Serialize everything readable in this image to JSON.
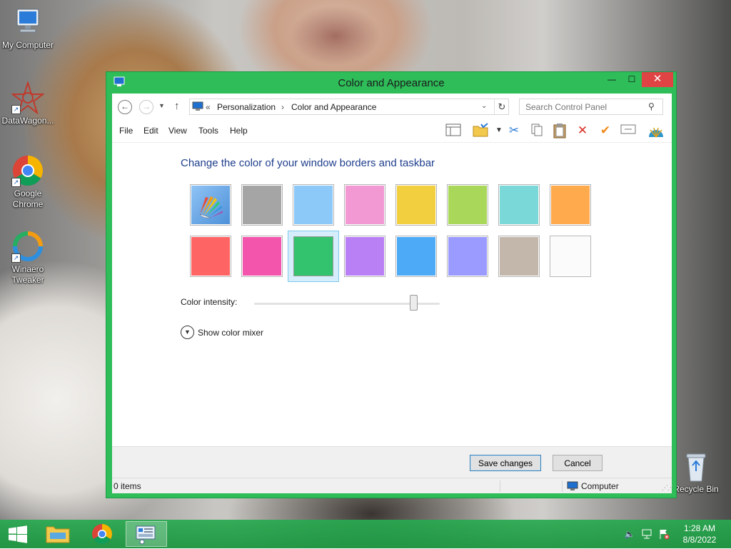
{
  "desktop": {
    "icons": [
      {
        "label": "My Computer",
        "icon": "computer-icon"
      },
      {
        "label": "DataWagon...",
        "icon": "datawagon-icon"
      },
      {
        "label": "Google Chrome",
        "icon": "chrome-icon"
      },
      {
        "label": "Winaero Tweaker",
        "icon": "winaero-icon"
      },
      {
        "label": "Recycle Bin",
        "icon": "recycle-bin-icon"
      }
    ]
  },
  "window": {
    "title": "Color and Appearance",
    "controls": {
      "minimize": "—",
      "maximize": "☐",
      "close": "✕"
    },
    "address": {
      "overflow": "«",
      "crumbs": [
        "Personalization",
        "Color and Appearance"
      ],
      "separator": "›"
    },
    "search": {
      "placeholder": "Search Control Panel"
    },
    "menu": [
      "File",
      "Edit",
      "View",
      "Tools",
      "Help"
    ],
    "toolbar_icons": [
      "layout-pane-icon",
      "folder-options-icon",
      "dropdown-arrow-icon",
      "cut-icon",
      "copy-icon",
      "paste-icon",
      "delete-icon",
      "properties-check-icon",
      "rename-icon",
      "shell-icon"
    ],
    "content": {
      "heading": "Change the color of your window borders and taskbar",
      "swatches": [
        {
          "name": "automatic",
          "color": "#5b9bd5",
          "selected": false
        },
        {
          "name": "gray",
          "color": "#a5a5a5",
          "selected": false
        },
        {
          "name": "sky-blue",
          "color": "#8cc8f8",
          "selected": false
        },
        {
          "name": "pink",
          "color": "#f299d4",
          "selected": false
        },
        {
          "name": "yellow",
          "color": "#f2cf3e",
          "selected": false
        },
        {
          "name": "lime",
          "color": "#a9d75a",
          "selected": false
        },
        {
          "name": "teal",
          "color": "#7ad8d8",
          "selected": false
        },
        {
          "name": "orange",
          "color": "#ffaa4d",
          "selected": false
        },
        {
          "name": "red",
          "color": "#ff6464",
          "selected": false
        },
        {
          "name": "magenta",
          "color": "#f354ac",
          "selected": false
        },
        {
          "name": "green",
          "color": "#33c26d",
          "selected": true
        },
        {
          "name": "violet",
          "color": "#b97ff5",
          "selected": false
        },
        {
          "name": "blue",
          "color": "#4caaf7",
          "selected": false
        },
        {
          "name": "periwinkle",
          "color": "#9b9bff",
          "selected": false
        },
        {
          "name": "taupe",
          "color": "#c2b7aa",
          "selected": false
        },
        {
          "name": "white",
          "color": "#fbfbfb",
          "selected": false
        }
      ],
      "intensity_label": "Color intensity:",
      "intensity_value": 0.86,
      "mixer_label": "Show color mixer"
    },
    "buttons": {
      "save": "Save changes",
      "cancel": "Cancel"
    },
    "status": {
      "items": "0 items",
      "location": "Computer"
    }
  },
  "taskbar": {
    "apps": [
      "start-icon",
      "file-explorer-icon",
      "chrome-icon",
      "control-panel-icon"
    ],
    "tray": [
      "speaker-muted-icon",
      "network-icon",
      "flag-icon"
    ],
    "time": "1:28 AM",
    "date": "8/8/2022"
  },
  "colors": {
    "accent": "#2ebd59",
    "heading": "#1e3e8c",
    "close_button": "#e04343"
  }
}
